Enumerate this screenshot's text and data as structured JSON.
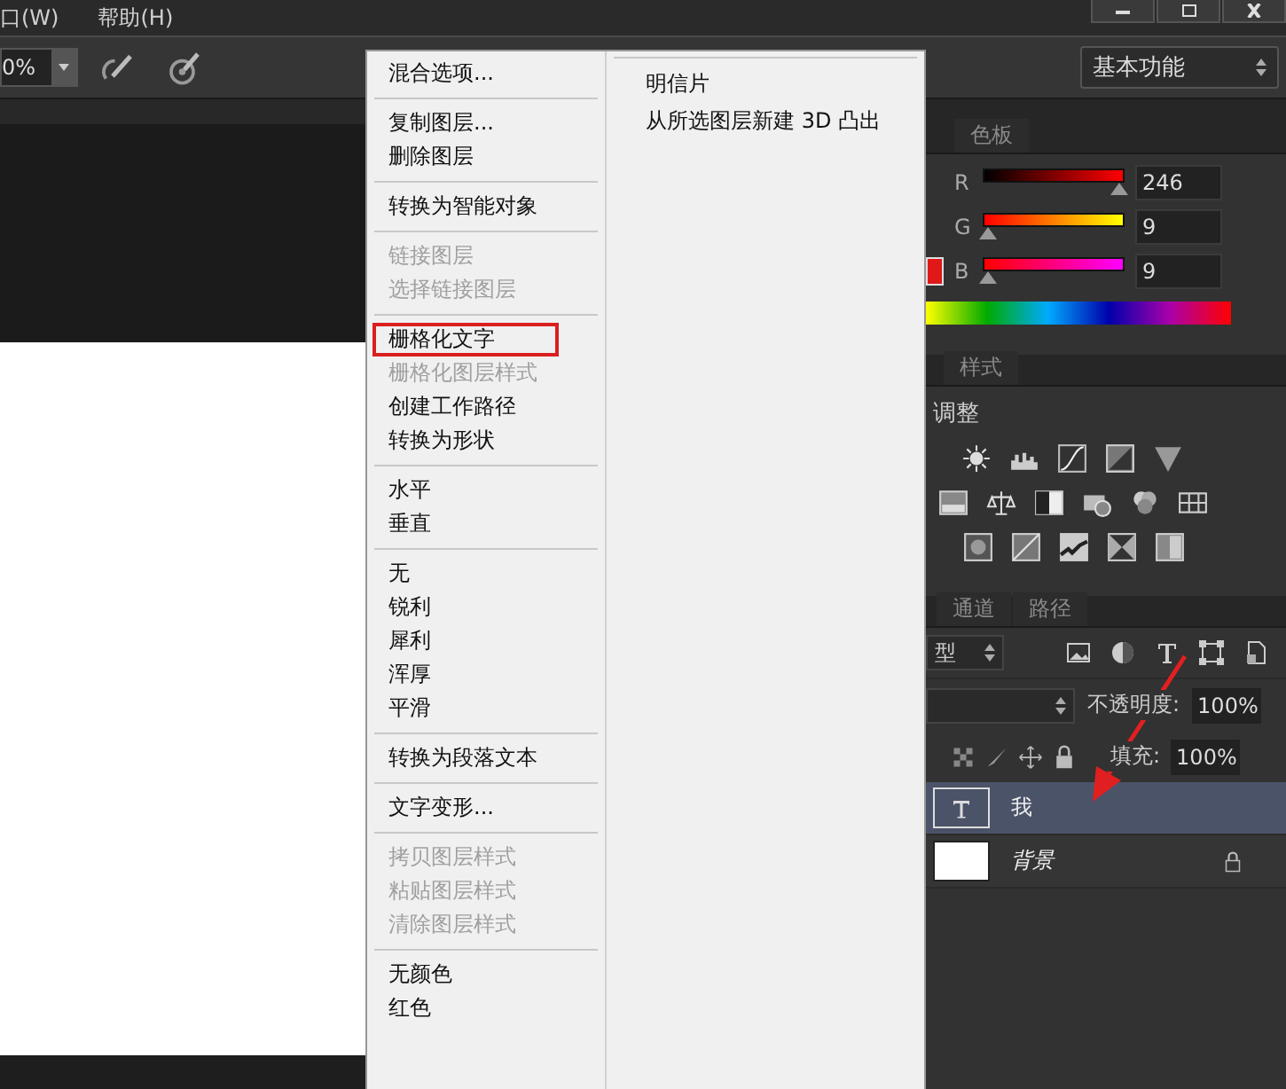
{
  "menubar": {
    "items": [
      "口(W)",
      "帮助(H)"
    ]
  },
  "options_bar": {
    "zoom_value": "0%",
    "workspace": "基本功能"
  },
  "context_menu": {
    "groups": [
      [
        {
          "label": "混合选项...",
          "disabled": false,
          "outlined": false
        }
      ],
      [
        {
          "label": "复制图层...",
          "disabled": false,
          "outlined": false
        },
        {
          "label": "删除图层",
          "disabled": false,
          "outlined": false
        }
      ],
      [
        {
          "label": "转换为智能对象",
          "disabled": false,
          "outlined": false
        }
      ],
      [
        {
          "label": "链接图层",
          "disabled": true,
          "outlined": false
        },
        {
          "label": "选择链接图层",
          "disabled": true,
          "outlined": false
        }
      ],
      [
        {
          "label": "栅格化文字",
          "disabled": false,
          "outlined": true
        },
        {
          "label": "栅格化图层样式",
          "disabled": true,
          "outlined": false
        },
        {
          "label": "创建工作路径",
          "disabled": false,
          "outlined": false
        },
        {
          "label": "转换为形状",
          "disabled": false,
          "outlined": false
        }
      ],
      [
        {
          "label": "水平",
          "disabled": false,
          "outlined": false
        },
        {
          "label": "垂直",
          "disabled": false,
          "outlined": false
        }
      ],
      [
        {
          "label": "无",
          "disabled": false,
          "outlined": false
        },
        {
          "label": "锐利",
          "disabled": false,
          "outlined": false
        },
        {
          "label": "犀利",
          "disabled": false,
          "outlined": false
        },
        {
          "label": "浑厚",
          "disabled": false,
          "outlined": false
        },
        {
          "label": "平滑",
          "disabled": false,
          "outlined": false
        }
      ],
      [
        {
          "label": "转换为段落文本",
          "disabled": false,
          "outlined": false
        }
      ],
      [
        {
          "label": "文字变形...",
          "disabled": false,
          "outlined": false
        }
      ],
      [
        {
          "label": "拷贝图层样式",
          "disabled": true,
          "outlined": false
        },
        {
          "label": "粘贴图层样式",
          "disabled": true,
          "outlined": false
        },
        {
          "label": "清除图层样式",
          "disabled": true,
          "outlined": false
        }
      ],
      [
        {
          "label": "无颜色",
          "disabled": false,
          "outlined": false
        },
        {
          "label": "红色",
          "disabled": false,
          "outlined": false
        }
      ]
    ],
    "submenu": [
      "明信片",
      "从所选图层新建 3D 凸出"
    ]
  },
  "color_panel": {
    "tab": "色板",
    "channels": [
      {
        "label": "R",
        "value": "246",
        "level": 0.965
      },
      {
        "label": "G",
        "value": "9",
        "level": 0.035
      },
      {
        "label": "B",
        "value": "9",
        "level": 0.035
      }
    ]
  },
  "styles_panel": {
    "tab": "样式"
  },
  "adjustments_panel": {
    "title": "调整"
  },
  "layers_panel": {
    "tabs": [
      "通道",
      "路径"
    ],
    "filter": "型",
    "opacity_label": "不透明度:",
    "opacity": "100%",
    "fill_label": "填充:",
    "fill": "100%",
    "layers": [
      {
        "name": "我",
        "kind": "text",
        "selected": true,
        "locked": false
      },
      {
        "name": "背景",
        "kind": "image",
        "selected": false,
        "locked": true
      }
    ]
  }
}
